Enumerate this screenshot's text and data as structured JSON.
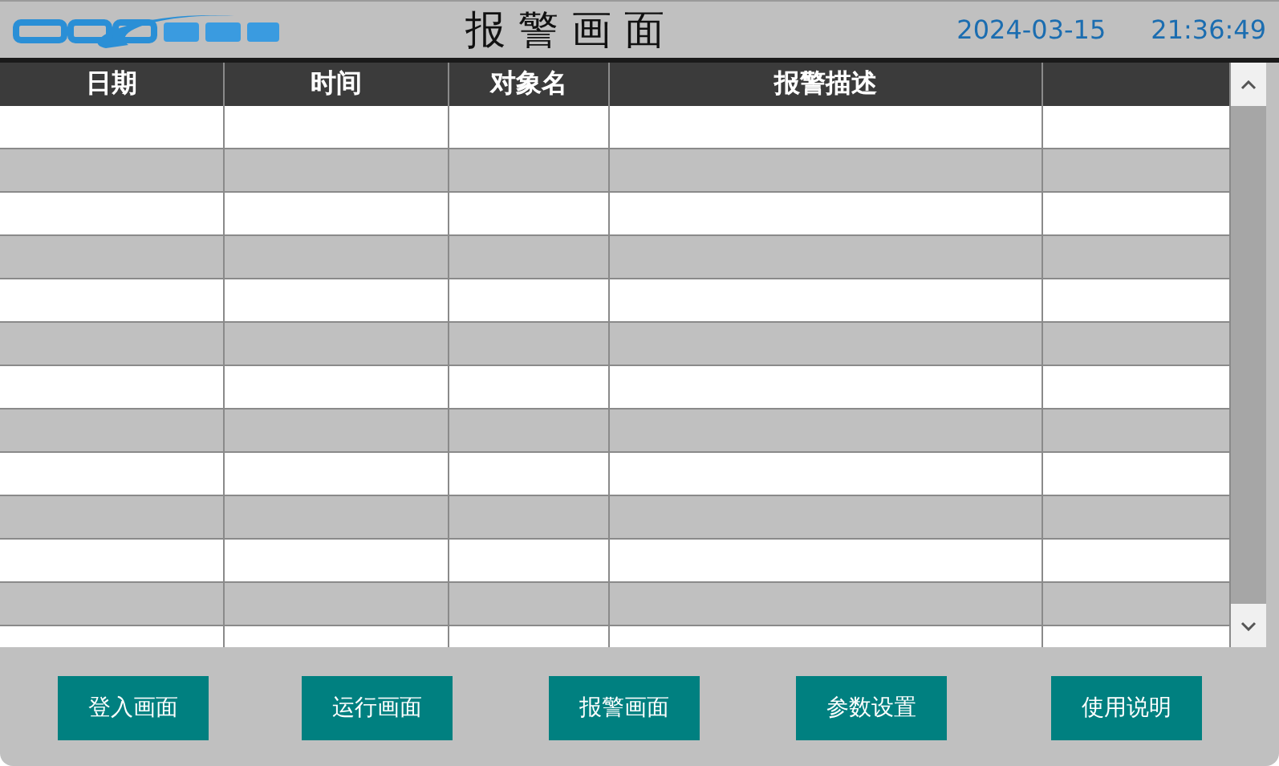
{
  "header": {
    "title": "报 警 画 面",
    "date": "2024-03-15",
    "time": "21:36:49"
  },
  "table": {
    "columns": [
      "日期",
      "时间",
      "对象名",
      "报警描述",
      ""
    ]
  },
  "buttons": [
    "登入画面",
    "运行画面",
    "报警画面",
    "参数设置",
    "使用说明"
  ]
}
